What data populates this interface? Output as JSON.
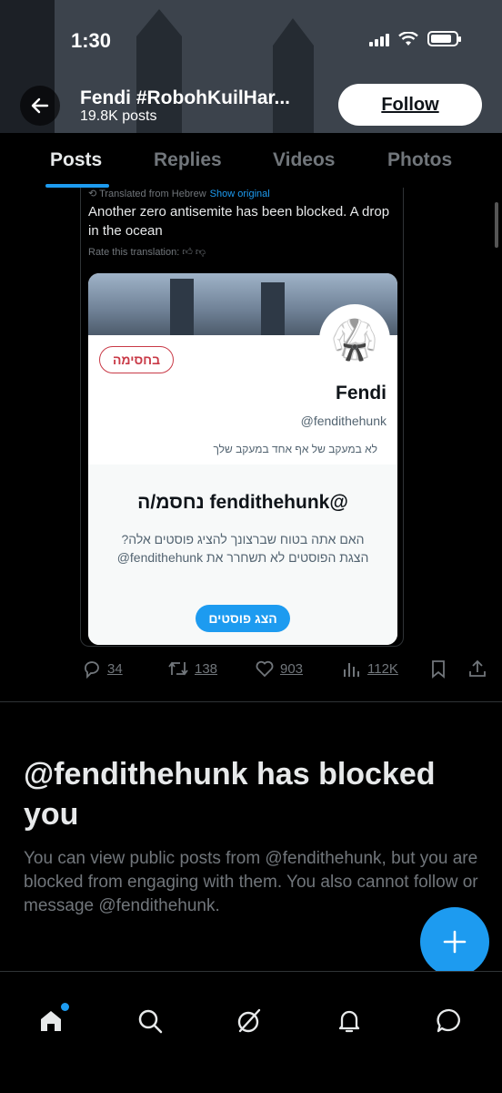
{
  "status_bar": {
    "time": "1:30"
  },
  "header": {
    "name": "Fendi #RobohKuilHar...",
    "posts_count": "19.8K posts",
    "follow_label": "Follow"
  },
  "tabs": [
    {
      "label": "Posts",
      "active": true
    },
    {
      "label": "Replies",
      "active": false
    },
    {
      "label": "Videos",
      "active": false
    },
    {
      "label": "Photos",
      "active": false
    }
  ],
  "embedded_post": {
    "translated_note": "Translated from Hebrew",
    "show_original": "Show original",
    "text": "Another zero antisemite has been blocked. A drop in the ocean",
    "rate_translation": "Rate this translation:",
    "card": {
      "blocked_pill": "בחסימה",
      "name": "Fendi",
      "handle": "@fendithehunk",
      "follow_info": "לא במעקב של אף אחד במעקב שלך",
      "blocked_title": "@fendithehunk נחסמ/ה",
      "blocked_body": "האם אתה בטוח שברצונך להציג פוסטים אלה? הצגת הפוסטים לא תשחרר את fendithehunk@",
      "show_posts_button": "הצג פוסטים"
    }
  },
  "actions": {
    "replies": "34",
    "reposts": "138",
    "likes": "903",
    "views": "112K"
  },
  "blocked_notice": {
    "heading": "@fendithehunk has blocked you",
    "body": "You can view public posts from @fendithehunk, but you are blocked from engaging with them. You also cannot follow or message @fendithehunk."
  },
  "fab": {
    "icon": "plus-icon"
  },
  "bottom_nav": [
    {
      "name": "home-icon"
    },
    {
      "name": "search-icon"
    },
    {
      "name": "grok-icon"
    },
    {
      "name": "notifications-icon"
    },
    {
      "name": "messages-icon"
    }
  ],
  "colors": {
    "accent": "#1d9bf0",
    "background": "#000000",
    "muted": "#71767b"
  }
}
